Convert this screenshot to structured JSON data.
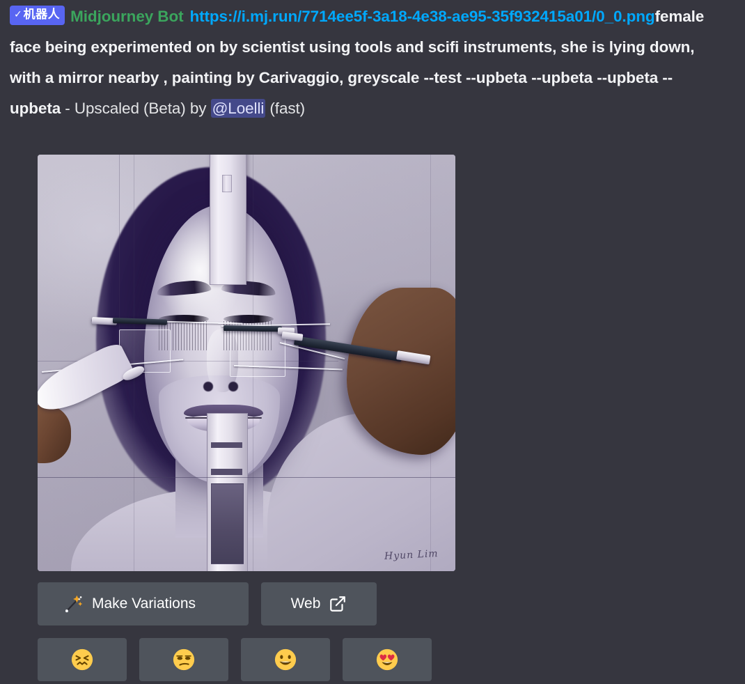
{
  "message": {
    "bot_tag": {
      "check": "✓",
      "label": "机器人"
    },
    "username": "Midjourney Bot",
    "link": "https://i.mj.run/7714ee5f-3a18-4e38-ae95-35f932415a01/0_0.png",
    "prompt": "female face being experimented on by scientist using tools and scifi instruments, she is lying down, with a mirror nearby , painting by Carivaggio, greyscale --test --upbeta --upbeta --upbeta --upbeta",
    "separator": " - ",
    "action_label": "Upscaled (Beta) by ",
    "mention": "@Loelli",
    "speed": " (fast)"
  },
  "attachment": {
    "alt": "Greyscale painting of a female face with scientific instruments and hands holding probes",
    "signature": "Hyun Lim"
  },
  "buttons": [
    {
      "name": "make-variations",
      "label": "Make Variations",
      "icon": "magic-wand-icon"
    },
    {
      "name": "web",
      "label": "Web",
      "icon": "external-link-icon"
    }
  ],
  "reactions": [
    {
      "name": "confounded-face",
      "emoji": "😖"
    },
    {
      "name": "unamused-face",
      "emoji": "😒"
    },
    {
      "name": "grinning-face",
      "emoji": "😃"
    },
    {
      "name": "heart-eyes-face",
      "emoji": "😍"
    }
  ],
  "colors": {
    "background": "#36363f",
    "button": "#4f545c",
    "bot_tag": "#5865f2",
    "username": "#3ba55d",
    "link": "#00a8fc",
    "mention_bg": "#5865f2"
  }
}
